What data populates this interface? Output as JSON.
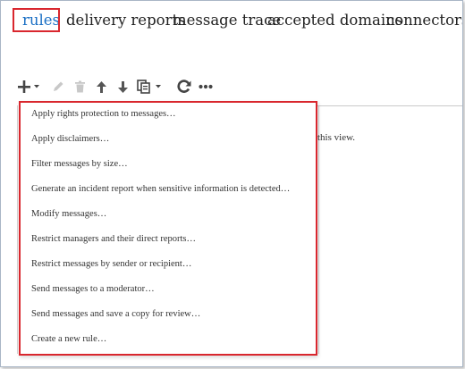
{
  "tabs": [
    {
      "label": "rules",
      "active": true
    },
    {
      "label": "delivery reports"
    },
    {
      "label": "message trace"
    },
    {
      "label": "accepted domains"
    },
    {
      "label": "connectors"
    }
  ],
  "toolbar": {
    "icons": [
      "plus-icon",
      "pencil-icon",
      "trash-icon",
      "arrow-up-icon",
      "arrow-down-icon",
      "copy-icon",
      "refresh-icon",
      "ellipsis-icon"
    ]
  },
  "background_text": "this view.",
  "menu": {
    "items": [
      "Apply rights protection to messages…",
      "Apply disclaimers…",
      "Filter messages by size…",
      "Generate an incident report when sensitive information is detected…",
      "Modify messages…",
      "Restrict managers and their direct reports…",
      "Restrict messages by sender or recipient…",
      "Send messages to a moderator…",
      "Send messages and save a copy for review…",
      "Create a new rule…"
    ]
  },
  "colors": {
    "accent": "#1a6fc4",
    "highlight": "#d9272e"
  }
}
